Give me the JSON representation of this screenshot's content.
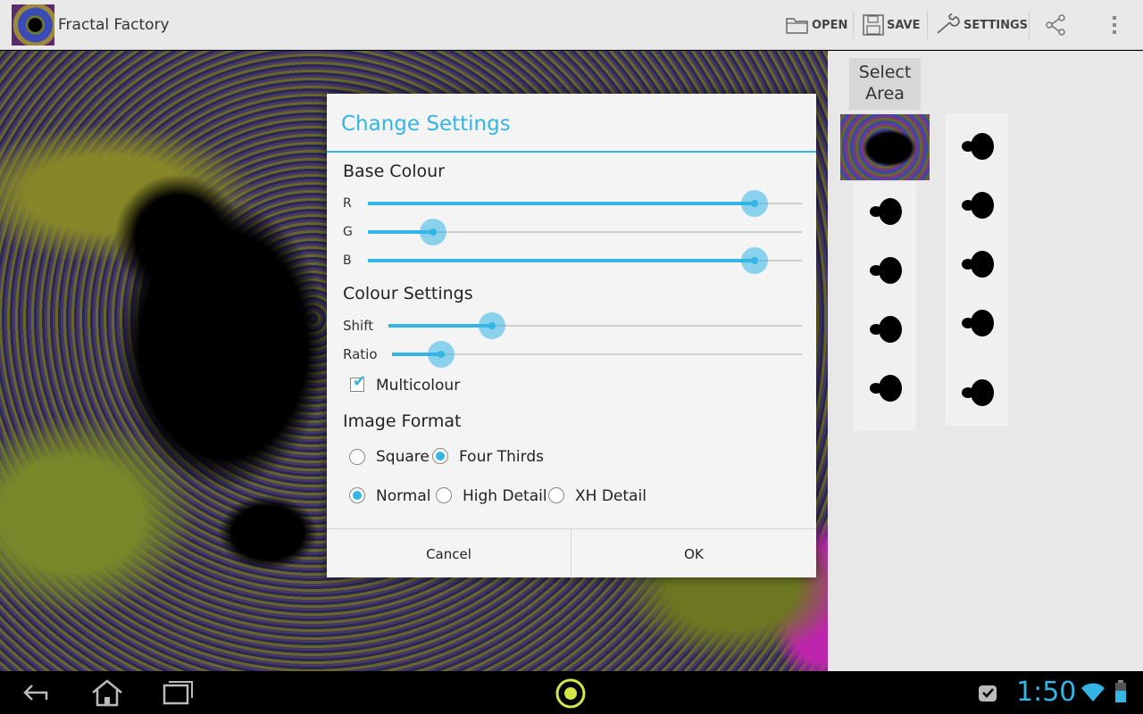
{
  "app": {
    "title": "Fractal Factory"
  },
  "actionbar": {
    "open_label": "OPEN",
    "save_label": "SAVE",
    "settings_label": "SETTINGS"
  },
  "side": {
    "select_area_label": "Select\nArea"
  },
  "dialog": {
    "title": "Change Settings",
    "base_colour": {
      "heading": "Base Colour",
      "r_label": "R",
      "r_value": 0.89,
      "g_label": "G",
      "g_value": 0.15,
      "b_label": "B",
      "b_value": 0.89
    },
    "colour_settings": {
      "heading": "Colour Settings",
      "shift_label": "Shift",
      "shift_value": 0.25,
      "ratio_label": "Ratio",
      "ratio_value": 0.12,
      "multicolour_label": "Multicolour",
      "multicolour_checked": true
    },
    "image_format": {
      "heading": "Image Format",
      "aspect_options": [
        "Square",
        "Four Thirds"
      ],
      "aspect_selected": "Four Thirds",
      "detail_options": [
        "Normal",
        "High Detail",
        "XH Detail"
      ],
      "detail_selected": "Normal"
    },
    "cancel_label": "Cancel",
    "ok_label": "OK"
  },
  "status": {
    "time": "1:50"
  },
  "colors": {
    "accent": "#33b5e5"
  }
}
